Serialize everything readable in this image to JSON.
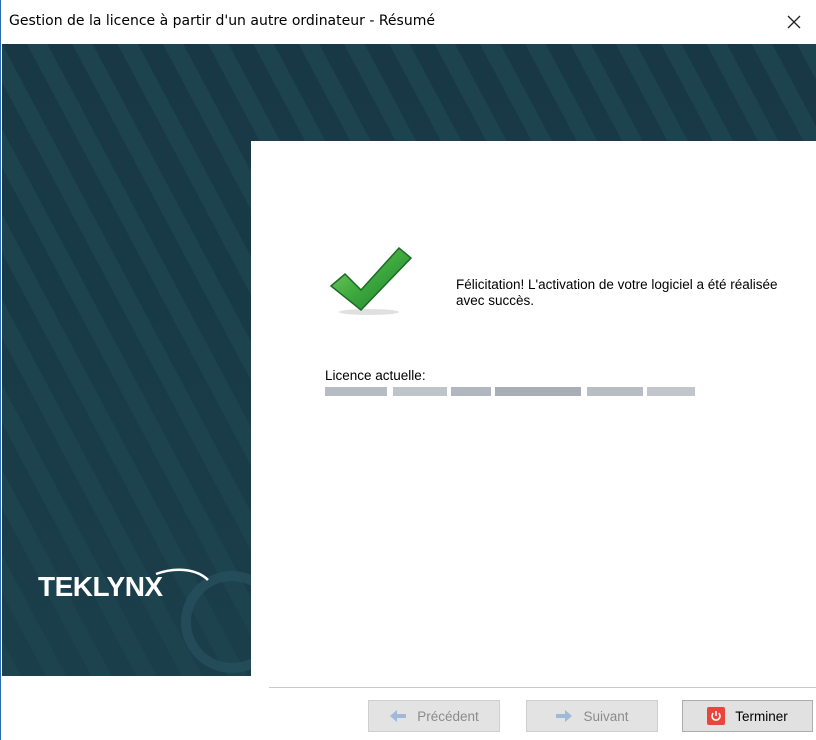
{
  "window": {
    "title": "Gestion de la licence à partir d'un autre ordinateur - Résumé",
    "close_icon": "close-icon"
  },
  "summary": {
    "message": "Félicitation! L'activation de votre logiciel a été réalisée avec succès.",
    "license_label": "Licence actuelle:",
    "success_icon": "checkmark-icon"
  },
  "branding": {
    "logo_text": "TEKLYNX",
    "banner_color": "#1d434f"
  },
  "buttons": {
    "previous": {
      "label": "Précédent",
      "icon": "arrow-left-icon",
      "enabled": false
    },
    "next": {
      "label": "Suivant",
      "icon": "arrow-right-icon",
      "enabled": false
    },
    "finish": {
      "label": "Terminer",
      "icon": "power-stop-icon",
      "enabled": true
    }
  },
  "colors": {
    "accent_green": "#2f9a3a",
    "finish_icon": "#e8453c",
    "arrow_blue": "#3b82c4"
  }
}
